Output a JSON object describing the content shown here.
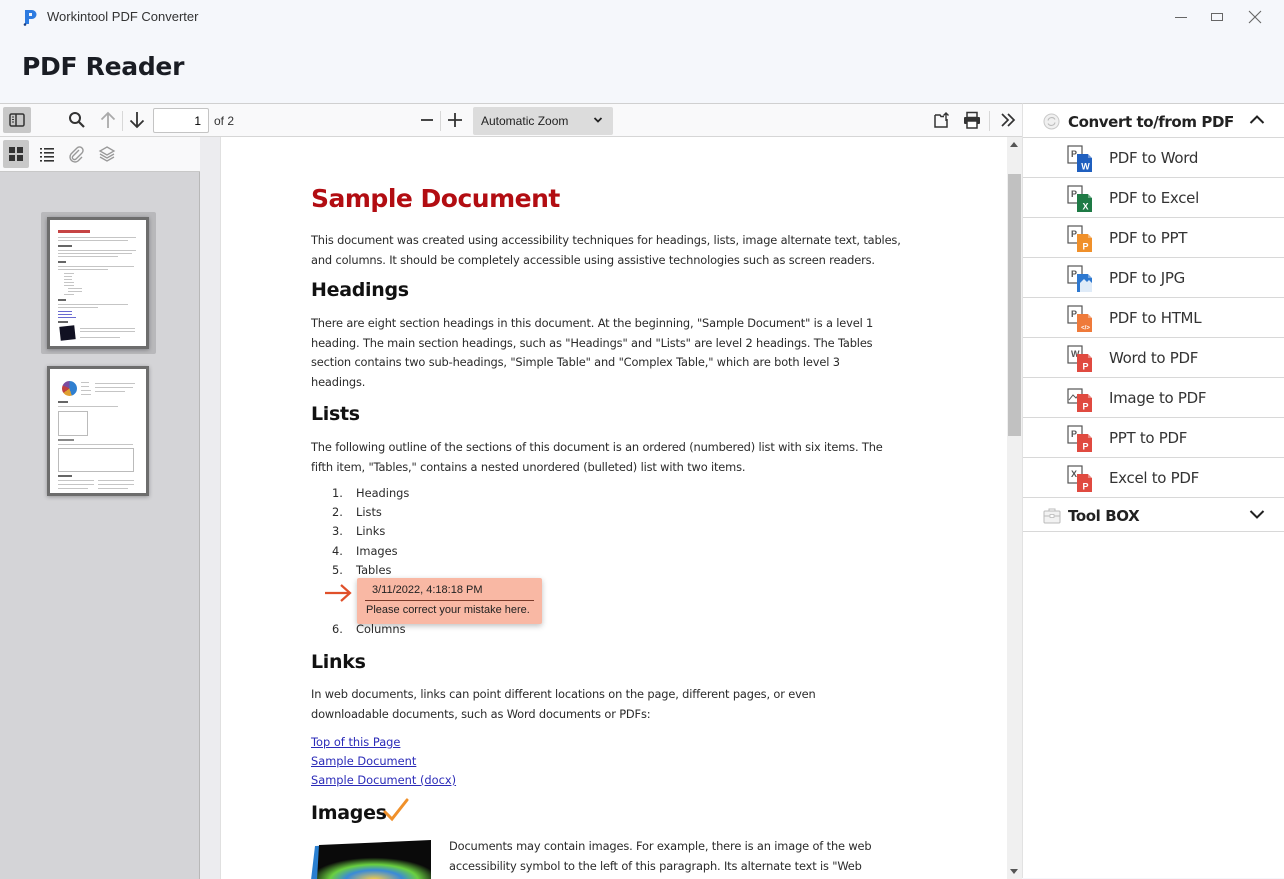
{
  "window": {
    "app_title": "Workintool PDF Converter",
    "controls": [
      "minimize",
      "maximize",
      "close"
    ]
  },
  "page_title": "PDF Reader",
  "toolbar": {
    "current_page": "1",
    "page_count_label": "of 2",
    "zoom_value": "Automatic Zoom",
    "icons": [
      "sidebar-toggle-icon",
      "search-icon",
      "arrow-up-icon",
      "arrow-down-icon",
      "minus-icon",
      "plus-icon",
      "open-file-icon",
      "print-icon",
      "double-chevron-right-icon"
    ]
  },
  "sidebar": {
    "tabs": [
      {
        "name": "thumbnails",
        "icon": "grid-icon",
        "active": true
      },
      {
        "name": "outline",
        "icon": "list-icon",
        "active": false
      },
      {
        "name": "attachments",
        "icon": "paperclip-icon",
        "active": false
      },
      {
        "name": "layers",
        "icon": "layers-icon",
        "active": false
      }
    ],
    "thumbnails": [
      {
        "page": 1,
        "selected": true
      },
      {
        "page": 2,
        "selected": false
      }
    ]
  },
  "document": {
    "title": "Sample Document",
    "intro": "This document was created using accessibility techniques for headings, lists, image alternate text, tables, and columns. It should be completely accessible using assistive technologies such as screen readers.",
    "sections": {
      "headings": {
        "heading": "Headings",
        "body": "There are eight section headings in this document. At the beginning, \"Sample Document\" is a level 1 heading. The main section headings, such as \"Headings\" and \"Lists\" are level 2 headings. The Tables section contains two sub-headings, \"Simple Table\" and \"Complex Table,\" which are both level 3 headings."
      },
      "lists": {
        "heading": "Lists",
        "body": "The following outline of the sections of this document is an ordered (numbered) list with six items. The fifth item, \"Tables,\" contains a nested unordered (bulleted) list with two items.",
        "items": [
          {
            "num": "1.",
            "text": "Headings"
          },
          {
            "num": "2.",
            "text": "Lists"
          },
          {
            "num": "3.",
            "text": "Links"
          },
          {
            "num": "4.",
            "text": "Images"
          },
          {
            "num": "5.",
            "text": "Tables"
          },
          {
            "num": "6.",
            "text": "Columns"
          }
        ]
      },
      "links": {
        "heading": "Links",
        "body": "In web documents, links can point different locations on the page, different pages, or even downloadable documents, such as Word documents or PDFs:",
        "links": [
          "Top of this Page",
          "Sample Document",
          "Sample Document (docx)"
        ]
      },
      "images": {
        "heading": "Images",
        "body": "Documents may contain images. For example, there is an image of the web accessibility symbol to the left of this paragraph. Its alternate text is \"Web"
      }
    },
    "annotation": {
      "date": "3/11/2022, 4:18:18 PM",
      "text": "Please correct your mistake here.",
      "color": "#f9b8a4"
    }
  },
  "right_panel": {
    "convert_section": {
      "label": "Convert to/from PDF",
      "expanded": true,
      "items": [
        {
          "label": "PDF to Word",
          "icon": "pdf-to-word-icon",
          "badge": "W",
          "color": "#1f5fbf"
        },
        {
          "label": "PDF to Excel",
          "icon": "pdf-to-excel-icon",
          "badge": "X",
          "color": "#1e7a45"
        },
        {
          "label": "PDF to PPT",
          "icon": "pdf-to-ppt-icon",
          "badge": "P",
          "color": "#f0902a"
        },
        {
          "label": "PDF to JPG",
          "icon": "pdf-to-jpg-icon",
          "badge": "",
          "color": "#2d78d0"
        },
        {
          "label": "PDF to HTML",
          "icon": "pdf-to-html-icon",
          "badge": "</>",
          "color": "#ef7a3a"
        },
        {
          "label": "Word to PDF",
          "icon": "word-to-pdf-icon",
          "badge": "P",
          "color": "#e04a40"
        },
        {
          "label": "Image to PDF",
          "icon": "image-to-pdf-icon",
          "badge": "P",
          "color": "#e04a40"
        },
        {
          "label": "PPT to PDF",
          "icon": "ppt-to-pdf-icon",
          "badge": "P",
          "color": "#e04a40"
        },
        {
          "label": "Excel to PDF",
          "icon": "excel-to-pdf-icon",
          "badge": "P",
          "color": "#e04a40"
        }
      ]
    },
    "toolbox_section": {
      "label": "Tool BOX",
      "expanded": false
    }
  },
  "colors": {
    "brand": "#2d7be0",
    "doc_title": "#b20d12",
    "link": "#2b2bb8",
    "annotation_arrow": "#e0502a",
    "checkmark": "#f0902a"
  }
}
